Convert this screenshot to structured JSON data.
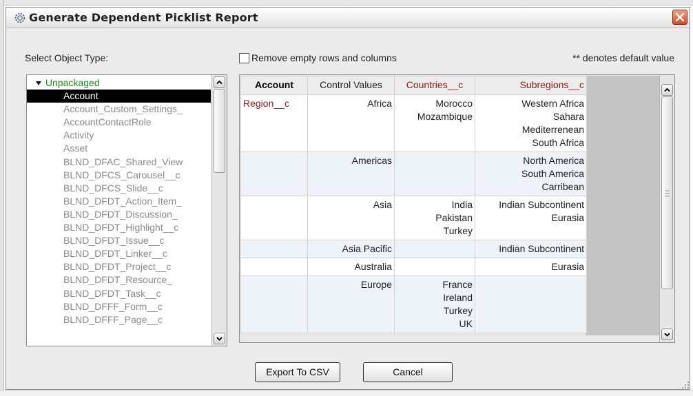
{
  "dialog": {
    "title": "Generate Dependent Picklist Report",
    "title_icon": "gear-icon",
    "close_icon": "close-icon"
  },
  "left": {
    "label": "Select Object Type:"
  },
  "options": {
    "remove_empty_label": "Remove empty rows and columns",
    "remove_empty_checked": false,
    "default_note": "** denotes default value"
  },
  "object_list": {
    "group_label": "Unpackaged",
    "group_icon": "triangle-down-icon",
    "items": [
      {
        "label": "Account",
        "selected": true
      },
      {
        "label": "Account_Custom_Settings_",
        "selected": false
      },
      {
        "label": "AccountContactRole",
        "selected": false
      },
      {
        "label": "Activity",
        "selected": false
      },
      {
        "label": "Asset",
        "selected": false
      },
      {
        "label": "BLND_DFAC_Shared_View",
        "selected": false
      },
      {
        "label": "BLND_DFCS_Carousel__c",
        "selected": false
      },
      {
        "label": "BLND_DFCS_Slide__c",
        "selected": false
      },
      {
        "label": "BLND_DFDT_Action_Item_",
        "selected": false
      },
      {
        "label": "BLND_DFDT_Discussion_",
        "selected": false
      },
      {
        "label": "BLND_DFDT_Highlight__c",
        "selected": false
      },
      {
        "label": "BLND_DFDT_Issue__c",
        "selected": false
      },
      {
        "label": "BLND_DFDT_Linker__c",
        "selected": false
      },
      {
        "label": "BLND_DFDT_Project__c",
        "selected": false
      },
      {
        "label": "BLND_DFDT_Resource_",
        "selected": false
      },
      {
        "label": "BLND_DFDT_Task__c",
        "selected": false
      },
      {
        "label": "BLND_DFFF_Form__c",
        "selected": false
      },
      {
        "label": "BLND_DFFF_Page__c",
        "selected": false
      }
    ]
  },
  "table": {
    "headers": [
      "Account",
      "Control Values",
      "Countries__c",
      "Subregions__c"
    ],
    "header_colors": [
      "#000000",
      "#222222",
      "#8b1a1a",
      "#8b1a1a"
    ],
    "rows": [
      {
        "label": "Region__c",
        "control": "Africa",
        "countries": [
          "Morocco",
          "Mozambique"
        ],
        "subregions": [
          "Western Africa",
          "Sahara",
          "Mediterrenean",
          "South Africa"
        ]
      },
      {
        "label": "",
        "control": "Americas",
        "countries": [],
        "subregions": [
          "North America",
          "South America",
          "Carribean"
        ]
      },
      {
        "label": "",
        "control": "Asia",
        "countries": [
          "India",
          "Pakistan",
          "Turkey"
        ],
        "subregions": [
          "Indian Subcontinent",
          "Eurasia"
        ]
      },
      {
        "label": "",
        "control": "Asia Pacific",
        "countries": [],
        "subregions": [
          "Indian Subcontinent"
        ]
      },
      {
        "label": "",
        "control": "Australia",
        "countries": [],
        "subregions": [
          "Eurasia"
        ]
      },
      {
        "label": "",
        "control": "Europe",
        "countries": [
          "France",
          "Ireland",
          "Turkey",
          "UK"
        ],
        "subregions": []
      }
    ]
  },
  "buttons": {
    "export": "Export To CSV",
    "cancel": "Cancel"
  }
}
